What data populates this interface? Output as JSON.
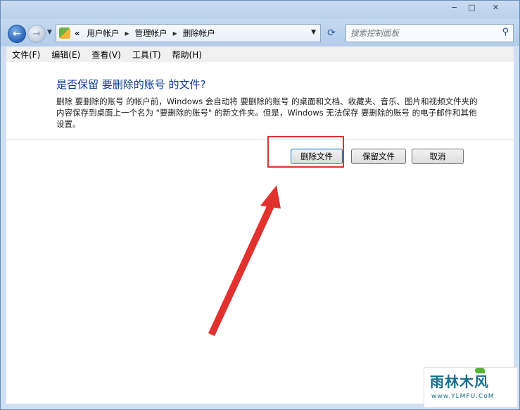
{
  "window": {
    "caption_buttons": {
      "minimize": "−",
      "maximize": "□",
      "close": "✕"
    }
  },
  "address_bar": {
    "overflow": "«",
    "breadcrumbs": [
      "用户帐户",
      "管理帐户",
      "删除帐户"
    ],
    "search_placeholder": "搜索控制面板"
  },
  "menu": [
    "文件(F)",
    "编辑(E)",
    "查看(V)",
    "工具(T)",
    "帮助(H)"
  ],
  "dialog": {
    "heading": "是否保留 要删除的账号 的文件?",
    "description": "删除 要删除的账号 的帐户前，Windows 会自动将 要删除的账号 的桌面和文档、收藏夹、音乐、图片和视频文件夹的内容保存到桌面上一个名为 \"要删除的账号\" 的新文件夹。但是，Windows 无法保存 要删除的账号 的电子邮件和其他设置。",
    "buttons": {
      "delete_files": "删除文件",
      "keep_files": "保留文件",
      "cancel": "取消"
    }
  },
  "annotation": {
    "highlight_color": "#e2322f"
  },
  "watermark": {
    "brand": "雨林木风",
    "url": "www.YLMFU.CoM"
  }
}
